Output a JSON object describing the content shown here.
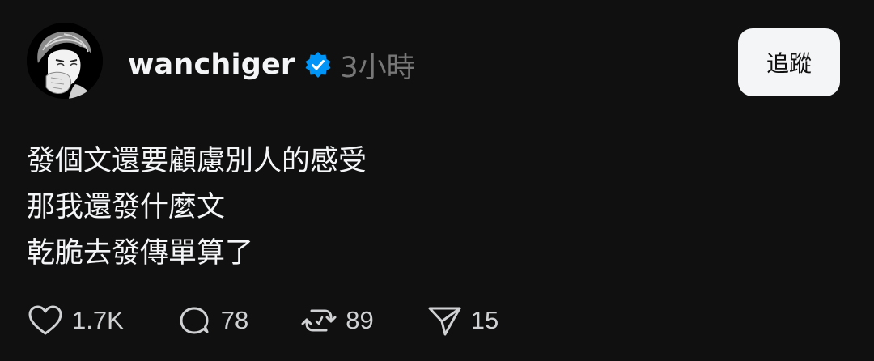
{
  "post": {
    "author": {
      "username": "wanchiger",
      "verified": true,
      "avatar_icon": "sketch-portrait-avatar",
      "verified_color": "#0095f6"
    },
    "timestamp": "3小時",
    "follow_label": "追蹤",
    "text_lines": [
      "發個文還要顧慮別人的感受",
      "那我還發什麼文",
      "乾脆去發傳單算了"
    ],
    "actions": {
      "like": {
        "icon": "heart-icon",
        "count": "1.7K"
      },
      "reply": {
        "icon": "comment-icon",
        "count": "78"
      },
      "repost": {
        "icon": "repost-icon",
        "count": "89"
      },
      "share": {
        "icon": "send-icon",
        "count": "15"
      }
    }
  },
  "colors": {
    "background": "#101010",
    "text": "#f3f5f7",
    "muted": "#777777",
    "button_bg": "#f3f5f7"
  }
}
